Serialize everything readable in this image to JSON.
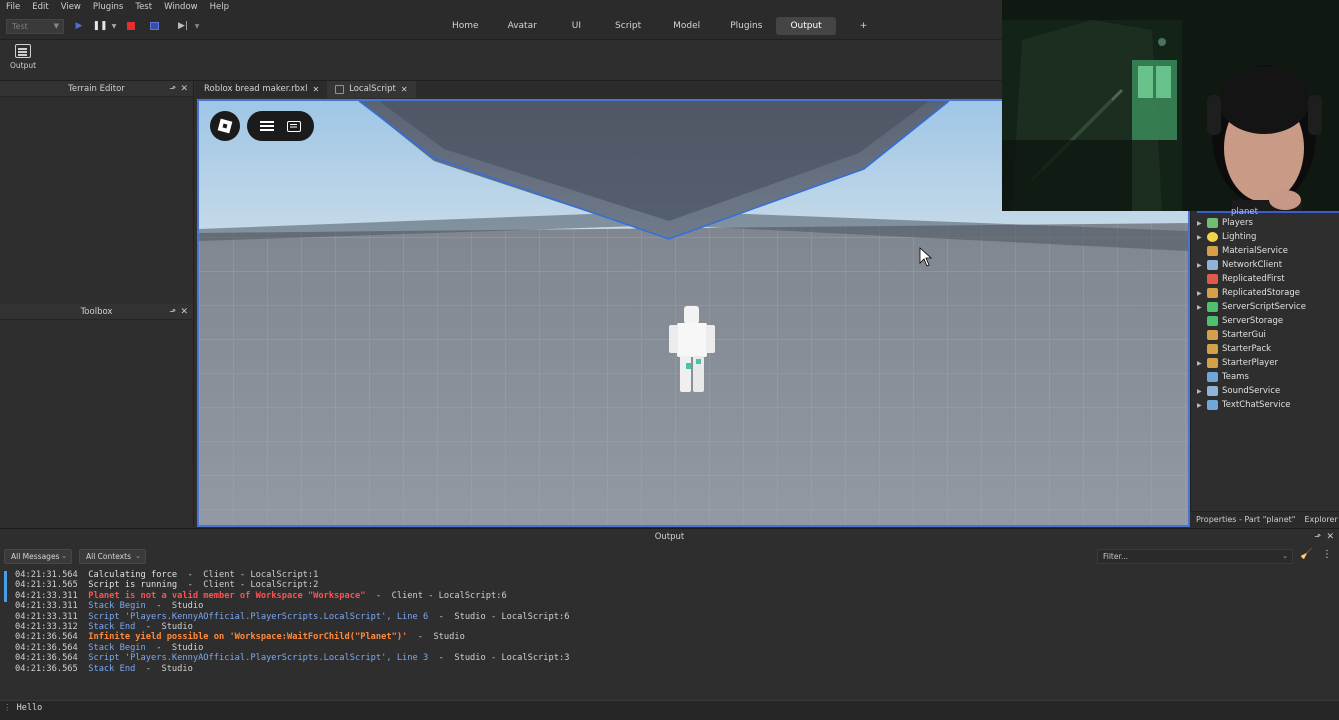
{
  "menubar": [
    "File",
    "Edit",
    "View",
    "Plugins",
    "Test",
    "Window",
    "Help"
  ],
  "toolbar": {
    "test_select": "Test",
    "ribbon_tabs": [
      "Home",
      "Avatar",
      "UI",
      "Script",
      "Model",
      "Plugins",
      "Output",
      "+"
    ],
    "active_tab": "Output",
    "output_button_label": "Output"
  },
  "left_panels": {
    "terrain": "Terrain Editor",
    "toolbox": "Toolbox"
  },
  "doc_tabs": [
    {
      "label": "Roblox bread maker.rbxl"
    },
    {
      "label": "LocalScript"
    }
  ],
  "explorer": {
    "partial_item": "planet",
    "items": [
      {
        "label": "Players",
        "expandable": true,
        "icon": "players-icon",
        "color": "#6fbf73"
      },
      {
        "label": "Lighting",
        "expandable": true,
        "icon": "lighting-icon",
        "color": "#f2d24b"
      },
      {
        "label": "MaterialService",
        "expandable": false,
        "icon": "material-service-icon",
        "color": "#d6a04a"
      },
      {
        "label": "NetworkClient",
        "expandable": true,
        "icon": "network-client-icon",
        "color": "#8fb3d9"
      },
      {
        "label": "ReplicatedFirst",
        "expandable": false,
        "icon": "replicated-first-icon",
        "color": "#e05a4a"
      },
      {
        "label": "ReplicatedStorage",
        "expandable": true,
        "icon": "replicated-storage-icon",
        "color": "#d6a04a"
      },
      {
        "label": "ServerScriptService",
        "expandable": true,
        "icon": "server-script-service-icon",
        "color": "#4fc16e"
      },
      {
        "label": "ServerStorage",
        "expandable": false,
        "icon": "server-storage-icon",
        "color": "#4fc16e"
      },
      {
        "label": "StarterGui",
        "expandable": false,
        "icon": "starter-gui-icon",
        "color": "#d6a04a"
      },
      {
        "label": "StarterPack",
        "expandable": false,
        "icon": "starter-pack-icon",
        "color": "#d6a04a"
      },
      {
        "label": "StarterPlayer",
        "expandable": true,
        "icon": "starter-player-icon",
        "color": "#d6a04a"
      },
      {
        "label": "Teams",
        "expandable": false,
        "icon": "teams-icon",
        "color": "#6fa7d9"
      },
      {
        "label": "SoundService",
        "expandable": true,
        "icon": "sound-service-icon",
        "color": "#8fb3d9"
      },
      {
        "label": "TextChatService",
        "expandable": true,
        "icon": "text-chat-service-icon",
        "color": "#6fa7d9"
      }
    ],
    "footer_properties": "Properties - Part \"planet\"",
    "footer_explorer": "Explorer"
  },
  "output": {
    "title": "Output",
    "messages_filter": "All Messages",
    "contexts_filter": "All Contexts",
    "filter_placeholder": "Filter...",
    "lines": [
      {
        "ts": "04:21:31.564",
        "msg": "Calculating force",
        "tail": "  -  Client - LocalScript:1",
        "kind": "white"
      },
      {
        "ts": "04:21:31.565",
        "msg": "Script is running",
        "tail": "  -  Client - LocalScript:2",
        "kind": "white"
      },
      {
        "ts": "04:21:33.311",
        "msg": "Planet is not a valid member of Workspace \"Workspace\"",
        "tail": "  -  Client - LocalScript:6",
        "kind": "red"
      },
      {
        "ts": "04:21:33.311",
        "msg": "Stack Begin",
        "tail": "  -  Studio",
        "kind": "blue"
      },
      {
        "ts": "04:21:33.311",
        "msg": "Script 'Players.KennyAOfficial.PlayerScripts.LocalScript', Line 6",
        "tail": "  -  Studio - LocalScript:6",
        "kind": "blue"
      },
      {
        "ts": "04:21:33.312",
        "msg": "Stack End",
        "tail": "  -  Studio",
        "kind": "blue"
      },
      {
        "ts": "04:21:36.564",
        "msg": "Infinite yield possible on 'Workspace:WaitForChild(\"Planet\")'",
        "tail": "  -  Studio",
        "kind": "orange"
      },
      {
        "ts": "04:21:36.564",
        "msg": "Stack Begin",
        "tail": "  -  Studio",
        "kind": "blue"
      },
      {
        "ts": "04:21:36.564",
        "msg": "Script 'Players.KennyAOfficial.PlayerScripts.LocalScript', Line 3",
        "tail": "  -  Studio - LocalScript:3",
        "kind": "blue"
      },
      {
        "ts": "04:21:36.565",
        "msg": "Stack End",
        "tail": "  -  Studio",
        "kind": "blue"
      }
    ]
  },
  "command_bar": {
    "value": "Hello"
  },
  "colors": {
    "accent": "#4a73d6",
    "error": "#ff5050",
    "warning": "#ff8a3d",
    "info": "#7ba8f0"
  }
}
